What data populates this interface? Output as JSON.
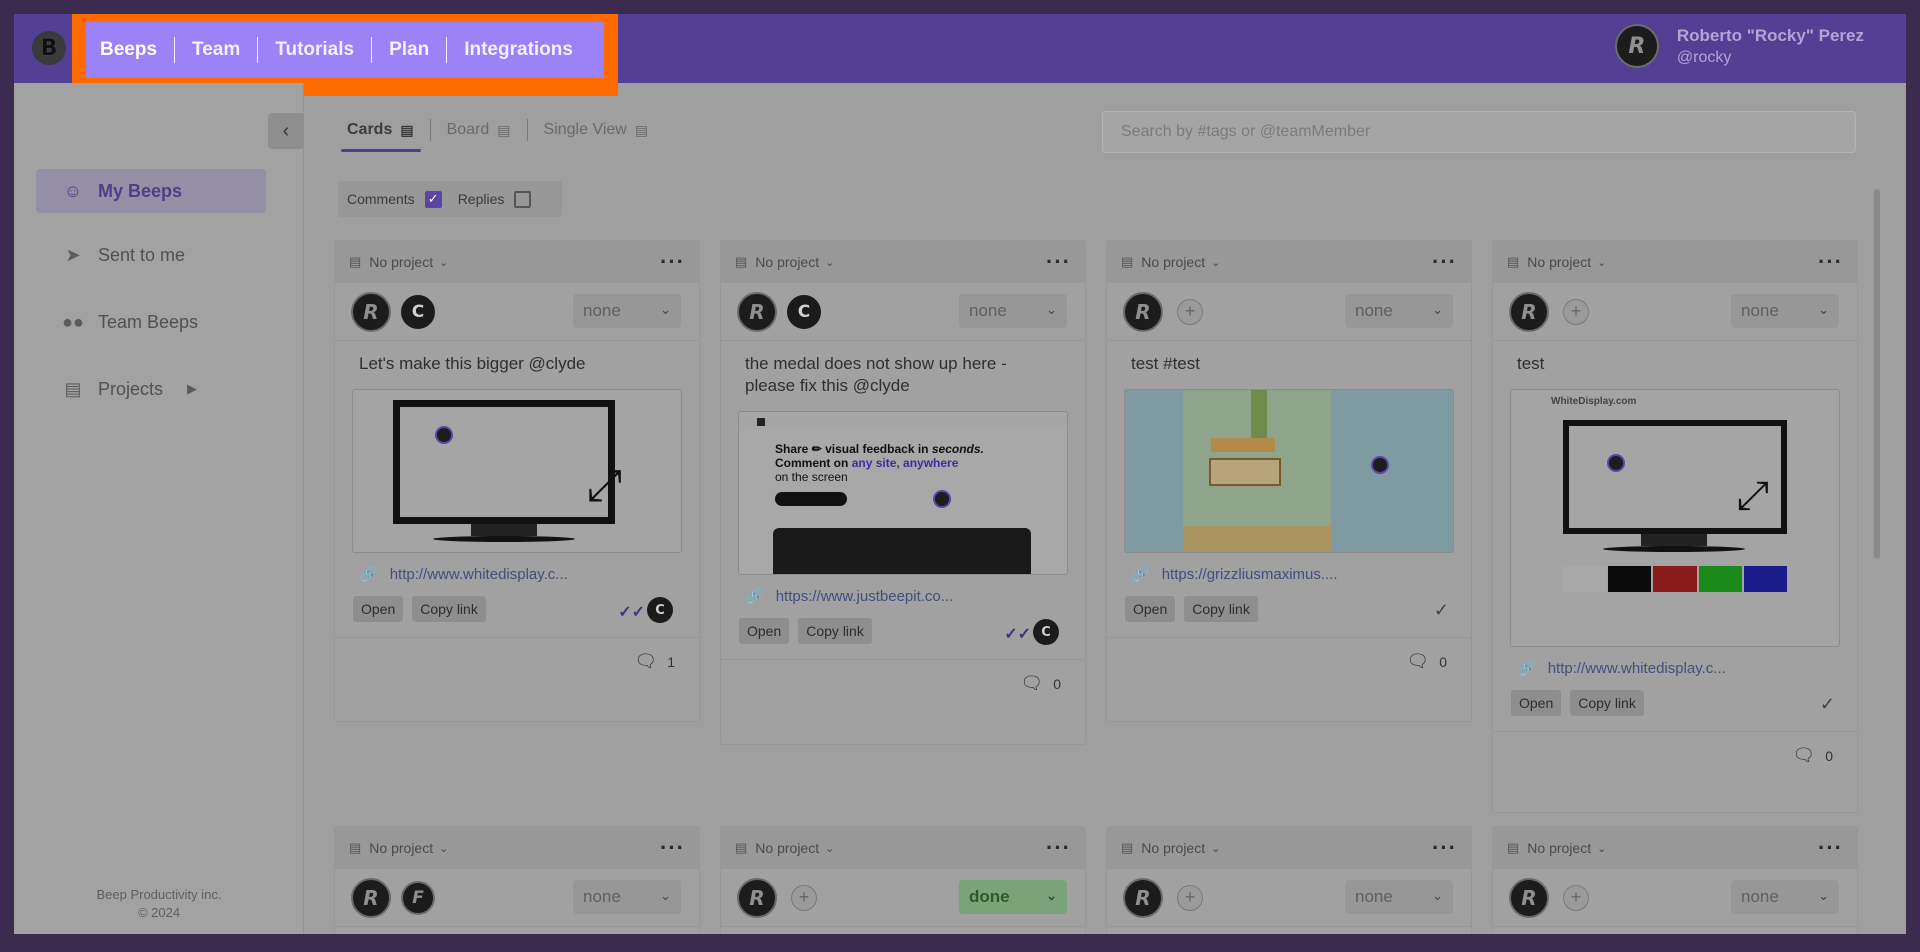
{
  "app": {
    "logo_letter": "B"
  },
  "nav": {
    "items": [
      "Beeps",
      "Team",
      "Tutorials",
      "Plan",
      "Integrations"
    ]
  },
  "user": {
    "name": "Roberto \"Rocky\" Perez",
    "handle": "@rocky",
    "avatar_letter": "R"
  },
  "sidebar": {
    "items": [
      {
        "label": "My Beeps",
        "icon": "user-circle-icon"
      },
      {
        "label": "Sent to me",
        "icon": "paper-plane-icon"
      },
      {
        "label": "Team Beeps",
        "icon": "team-icon"
      },
      {
        "label": "Projects",
        "icon": "list-icon"
      }
    ],
    "footer_line1": "Beep Productivity inc.",
    "footer_line2": "© 2024"
  },
  "views": {
    "tabs": [
      "Cards",
      "Board",
      "Single View"
    ],
    "active": "Cards"
  },
  "search": {
    "placeholder": "Search by #tags or @teamMember"
  },
  "filters": {
    "comments_label": "Comments",
    "comments_checked": true,
    "replies_label": "Replies",
    "replies_checked": false
  },
  "cards": [
    {
      "project": "No project",
      "status": "none",
      "text": "Let's make this bigger @clyde",
      "link": "http://www.whitedisplay.c...",
      "open_label": "Open",
      "copy_label": "Copy link",
      "comments": "1",
      "seen_by": "C",
      "second_person": "C"
    },
    {
      "project": "No project",
      "status": "none",
      "text": "the medal does not show up here - please fix this @clyde",
      "link": "https://www.justbeepit.co...",
      "open_label": "Open",
      "copy_label": "Copy link",
      "comments": "0",
      "seen_by": "C",
      "second_person": "C"
    },
    {
      "project": "No project",
      "status": "none",
      "text": "test #test",
      "link": "https://grizzliusmaximus....",
      "open_label": "Open",
      "copy_label": "Copy link",
      "comments": "0"
    },
    {
      "project": "No project",
      "status": "none",
      "text": "test",
      "link": "http://www.whitedisplay.c...",
      "open_label": "Open",
      "copy_label": "Copy link",
      "comments": "0"
    },
    {
      "project": "No project",
      "status": "none",
      "second_person": "F"
    },
    {
      "project": "No project",
      "status": "done"
    },
    {
      "project": "No project",
      "status": "none"
    },
    {
      "project": "No project",
      "status": "none"
    }
  ],
  "screenshots": {
    "justbeepit_headline_1": "Share",
    "justbeepit_headline_2": "visual feedback in",
    "justbeepit_headline_3": "seconds.",
    "justbeepit_headline_4": "Comment on",
    "justbeepit_headline_5": "any site, anywhere",
    "justbeepit_headline_6": "on the screen",
    "whitedisplay_logo": "WhiteDisplay.com"
  }
}
